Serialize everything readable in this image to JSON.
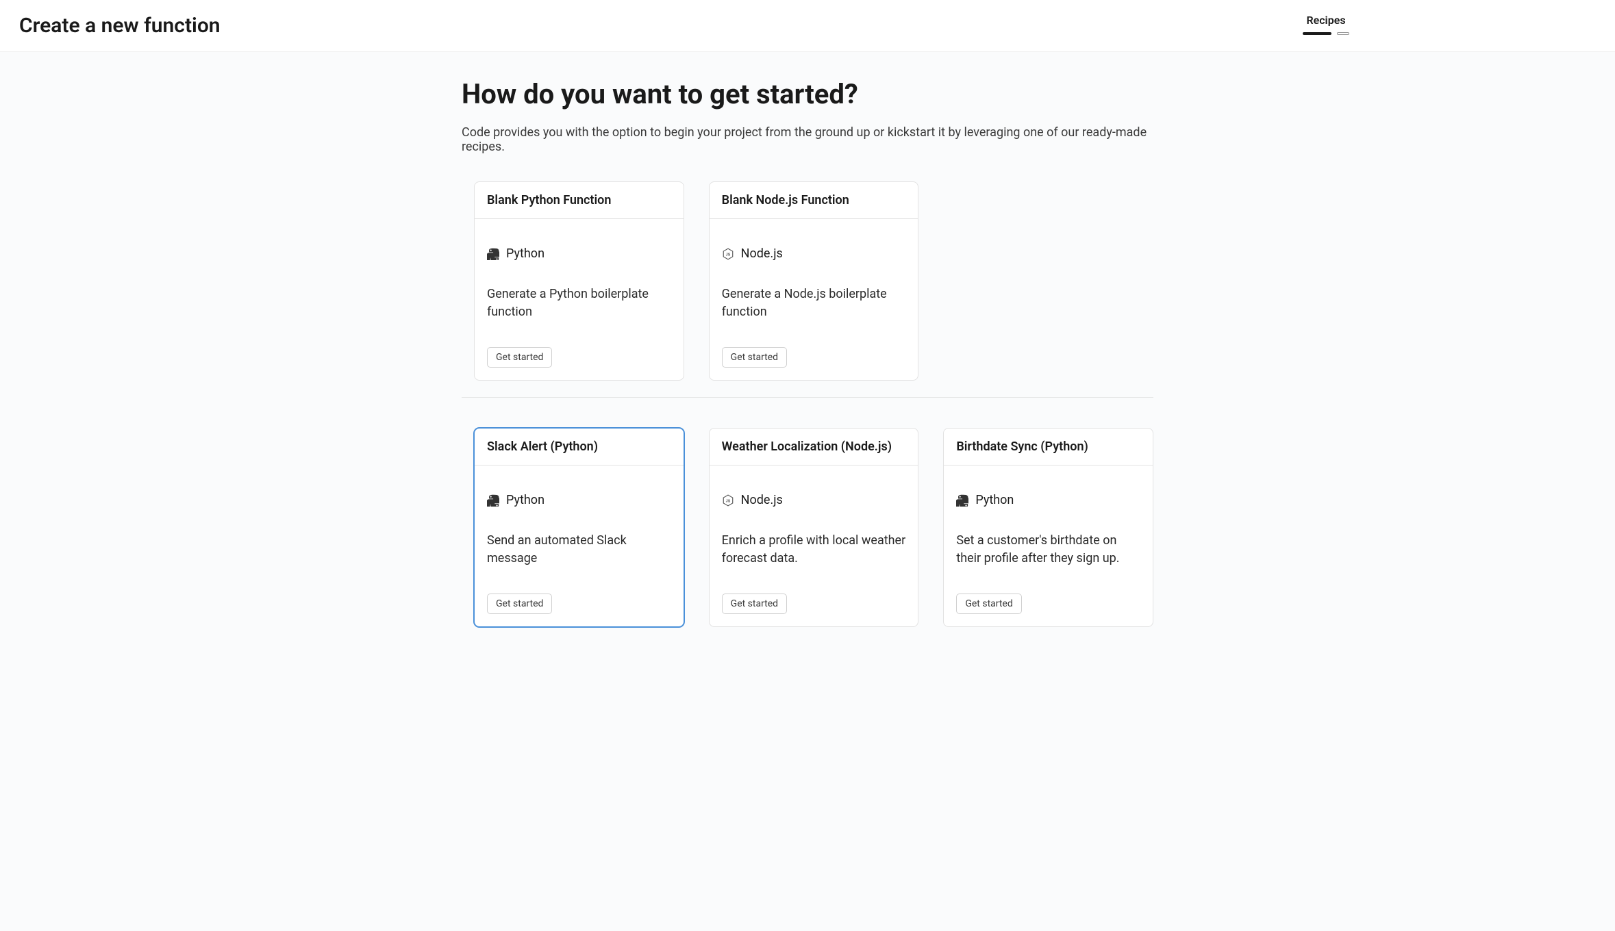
{
  "header": {
    "title": "Create a new function",
    "step_label": "Recipes"
  },
  "main": {
    "heading": "How do you want to get started?",
    "subtitle": "Code provides you with the option to begin your project from the ground up or kickstart it by leveraging one of our ready-made recipes."
  },
  "runtimes": {
    "python": "Python",
    "nodejs": "Node.js"
  },
  "blank_cards": [
    {
      "title": "Blank Python Function",
      "runtime": "python",
      "description": "Generate a Python boilerplate function",
      "button": "Get started",
      "selected": false
    },
    {
      "title": "Blank Node.js Function",
      "runtime": "nodejs",
      "description": "Generate a Node.js boilerplate function",
      "button": "Get started",
      "selected": false
    }
  ],
  "recipe_cards": [
    {
      "title": "Slack Alert (Python)",
      "runtime": "python",
      "description": "Send an automated Slack message",
      "button": "Get started",
      "selected": true
    },
    {
      "title": "Weather Localization (Node.js)",
      "runtime": "nodejs",
      "description": "Enrich a profile with local weather forecast data.",
      "button": "Get started",
      "selected": false
    },
    {
      "title": "Birthdate Sync (Python)",
      "runtime": "python",
      "description": "Set a customer's birthdate on their profile after they sign up.",
      "button": "Get started",
      "selected": false
    }
  ]
}
